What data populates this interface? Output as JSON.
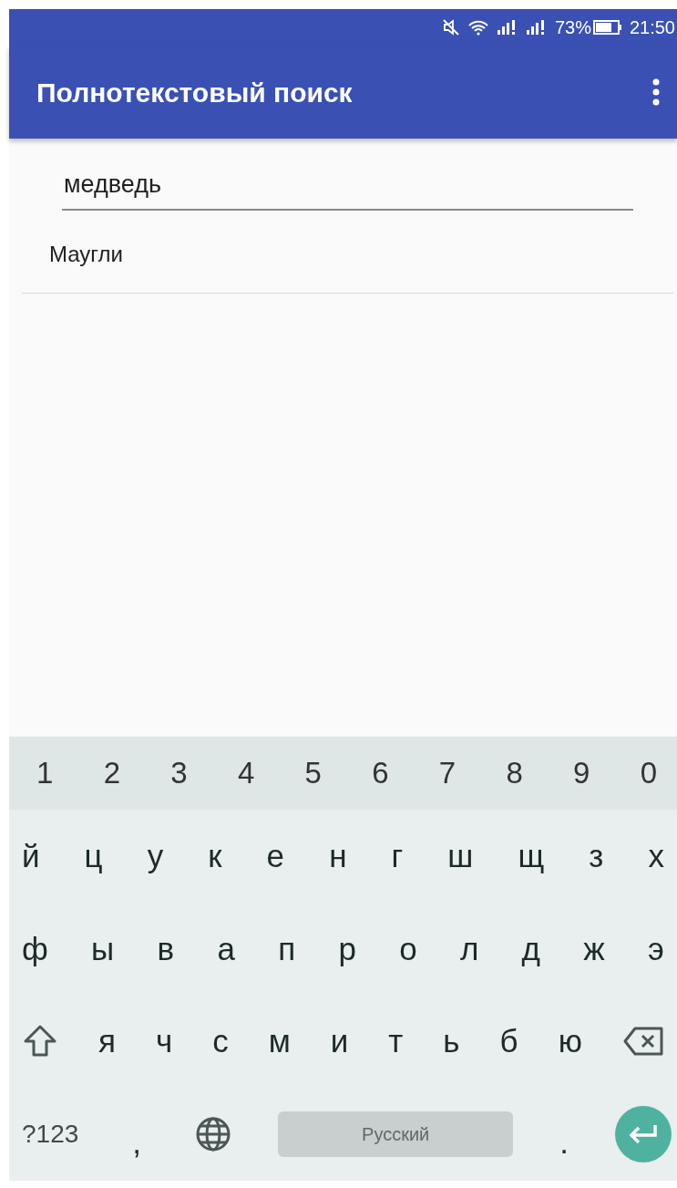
{
  "status_bar": {
    "battery": "73%",
    "time": "21:50"
  },
  "app_bar": {
    "title": "Полнотекстовый поиск"
  },
  "search_field": {
    "value": "медведь"
  },
  "results": [
    {
      "title": "Маугли"
    }
  ],
  "keyboard": {
    "number_row": [
      {
        "kind": "digit",
        "label": "1"
      },
      {
        "kind": "digit",
        "label": "2"
      },
      {
        "kind": "digit",
        "label": "3"
      },
      {
        "kind": "digit",
        "label": "4"
      },
      {
        "kind": "digit",
        "label": "5"
      },
      {
        "kind": "digit",
        "label": "6"
      },
      {
        "kind": "digit",
        "label": "7"
      },
      {
        "kind": "digit",
        "label": "8"
      },
      {
        "kind": "digit",
        "label": "9"
      },
      {
        "kind": "digit",
        "label": "0"
      }
    ],
    "letter_rows": [
      [
        {
          "kind": "char",
          "label": "й"
        },
        {
          "kind": "char",
          "label": "ц"
        },
        {
          "kind": "char",
          "label": "у"
        },
        {
          "kind": "char",
          "label": "к"
        },
        {
          "kind": "char",
          "label": "е"
        },
        {
          "kind": "char",
          "label": "н"
        },
        {
          "kind": "char",
          "label": "г"
        },
        {
          "kind": "char",
          "label": "ш"
        },
        {
          "kind": "char",
          "label": "щ"
        },
        {
          "kind": "char",
          "label": "з"
        },
        {
          "kind": "char",
          "label": "х"
        }
      ],
      [
        {
          "kind": "char",
          "label": "ф"
        },
        {
          "kind": "char",
          "label": "ы"
        },
        {
          "kind": "char",
          "label": "в"
        },
        {
          "kind": "char",
          "label": "а"
        },
        {
          "kind": "char",
          "label": "п"
        },
        {
          "kind": "char",
          "label": "р"
        },
        {
          "kind": "char",
          "label": "о"
        },
        {
          "kind": "char",
          "label": "л"
        },
        {
          "kind": "char",
          "label": "д"
        },
        {
          "kind": "char",
          "label": "ж"
        },
        {
          "kind": "char",
          "label": "э"
        }
      ],
      [
        {
          "kind": "shift"
        },
        {
          "kind": "char",
          "label": "я"
        },
        {
          "kind": "char",
          "label": "ч"
        },
        {
          "kind": "char",
          "label": "с"
        },
        {
          "kind": "char",
          "label": "м"
        },
        {
          "kind": "char",
          "label": "и"
        },
        {
          "kind": "char",
          "label": "т"
        },
        {
          "kind": "char",
          "label": "ь"
        },
        {
          "kind": "char",
          "label": "б"
        },
        {
          "kind": "char",
          "label": "ю"
        },
        {
          "kind": "backspace"
        }
      ]
    ],
    "bottom_row": [
      {
        "kind": "symbols",
        "label": "?123"
      },
      {
        "kind": "comma",
        "label": ","
      },
      {
        "kind": "globe"
      },
      {
        "kind": "space",
        "label": "Русский"
      },
      {
        "kind": "period",
        "label": "."
      },
      {
        "kind": "enter"
      }
    ]
  }
}
